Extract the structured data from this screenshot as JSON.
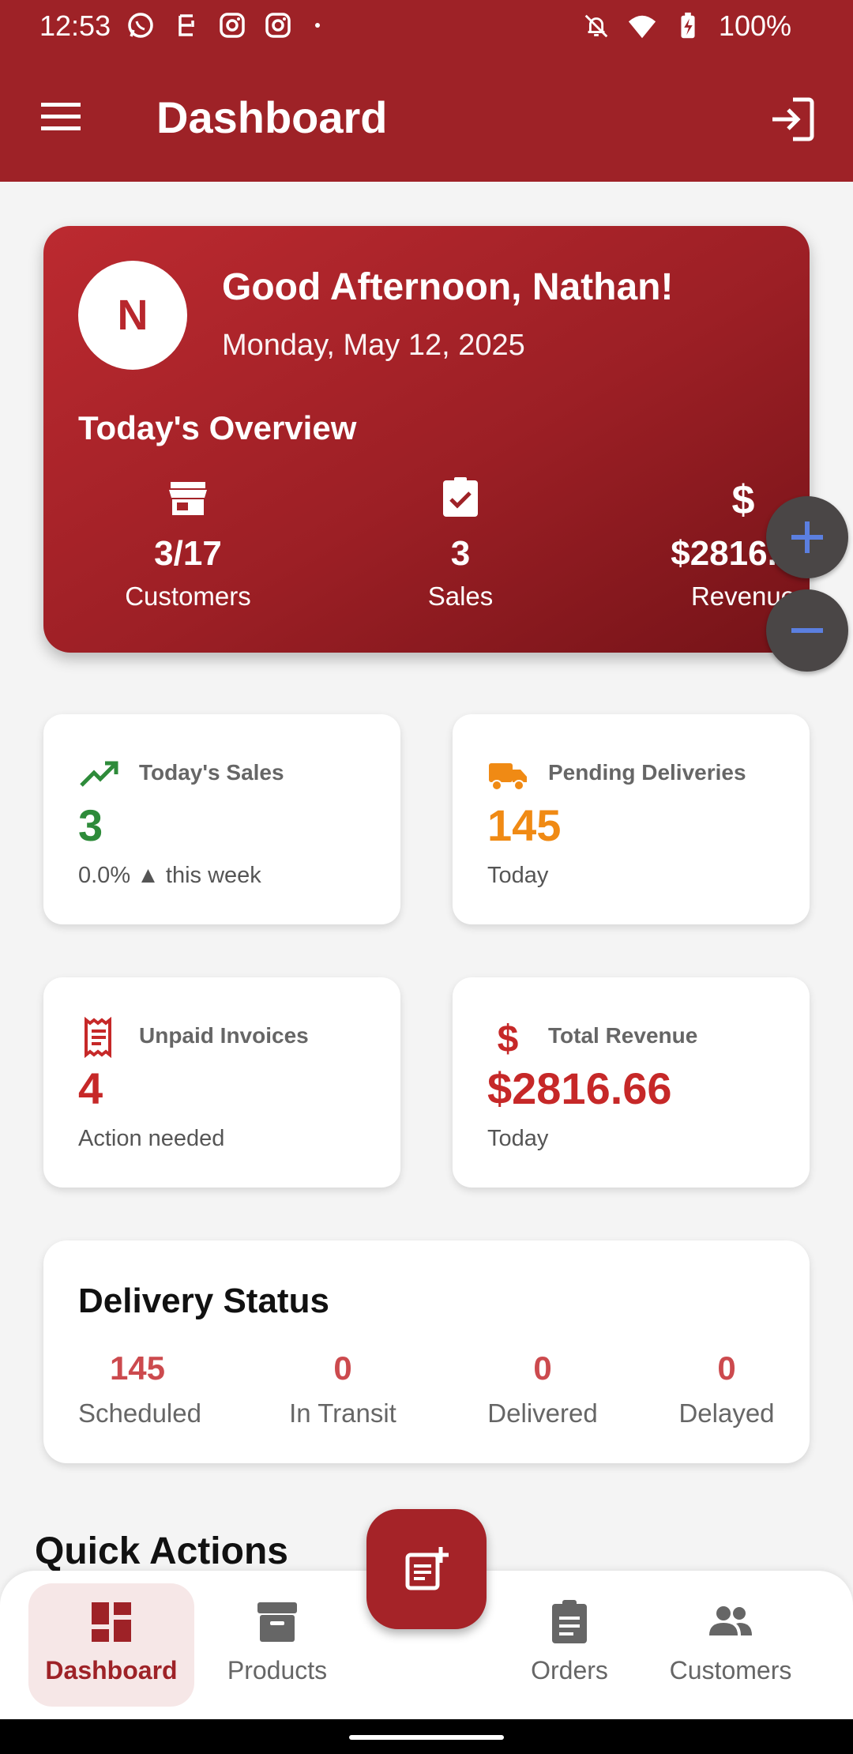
{
  "status_bar": {
    "time": "12:53",
    "battery": "100%"
  },
  "app_bar": {
    "title": "Dashboard"
  },
  "hero": {
    "avatar_initial": "N",
    "greeting": "Good Afternoon, Nathan!",
    "date": "Monday, May 12, 2025",
    "overview_title": "Today's Overview",
    "stats": [
      {
        "icon": "store-icon",
        "value": "3/17",
        "label": "Customers"
      },
      {
        "icon": "clipboard-check-icon",
        "value": "3",
        "label": "Sales"
      },
      {
        "icon": "dollar-icon",
        "value": "$2816.66",
        "label": "Revenue"
      }
    ]
  },
  "cards": {
    "todays_sales": {
      "title": "Today's Sales",
      "value": "3",
      "sub": "0.0% ▲ this week",
      "color": "#2e8b3a"
    },
    "pending_deliveries": {
      "title": "Pending Deliveries",
      "value": "145",
      "sub": "Today",
      "color": "#f08a14"
    },
    "unpaid_invoices": {
      "title": "Unpaid Invoices",
      "value": "4",
      "sub": "Action needed",
      "color": "#c62828"
    },
    "total_revenue": {
      "title": "Total Revenue",
      "value": "$2816.66",
      "sub": "Today",
      "color": "#c62828"
    }
  },
  "delivery_status": {
    "title": "Delivery Status",
    "items": [
      {
        "value": "145",
        "label": "Scheduled"
      },
      {
        "value": "0",
        "label": "In Transit"
      },
      {
        "value": "0",
        "label": "Delivered"
      },
      {
        "value": "0",
        "label": "Delayed"
      }
    ]
  },
  "quick_actions": {
    "title": "Quick Actions"
  },
  "bottom_nav": {
    "items": [
      {
        "label": "Dashboard",
        "icon": "dashboard-icon",
        "active": true
      },
      {
        "label": "Products",
        "icon": "archive-box-icon",
        "active": false
      },
      {
        "label": "Orders",
        "icon": "clipboard-icon",
        "active": false
      },
      {
        "label": "Customers",
        "icon": "people-icon",
        "active": false
      }
    ]
  },
  "colors": {
    "brand": "#9e2227",
    "accent_blue": "#5b7fe0"
  }
}
